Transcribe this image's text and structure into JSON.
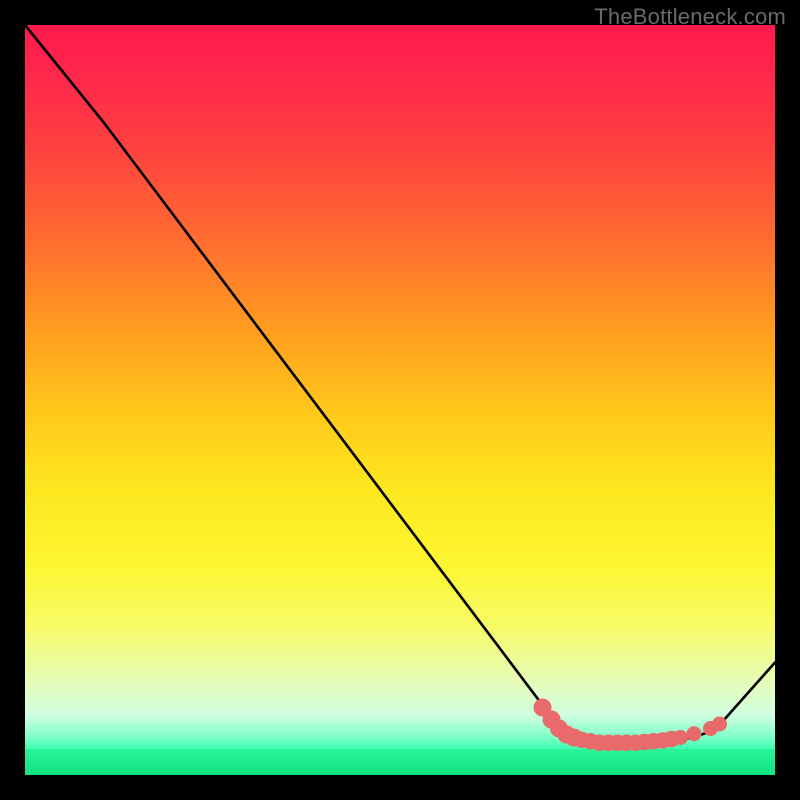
{
  "watermark": "TheBottleneck.com",
  "chart_data": {
    "type": "line",
    "title": "",
    "xlabel": "",
    "ylabel": "",
    "xlim": [
      0,
      100
    ],
    "ylim": [
      0,
      100
    ],
    "series": [
      {
        "name": "curve",
        "points": [
          {
            "x": 0.0,
            "y": 100.0
          },
          {
            "x": 10.5,
            "y": 87.0
          },
          {
            "x": 71.5,
            "y": 6.0
          },
          {
            "x": 74.0,
            "y": 4.5
          },
          {
            "x": 78.0,
            "y": 4.3
          },
          {
            "x": 82.0,
            "y": 4.3
          },
          {
            "x": 86.0,
            "y": 4.5
          },
          {
            "x": 89.0,
            "y": 5.0
          },
          {
            "x": 92.0,
            "y": 6.0
          },
          {
            "x": 100.0,
            "y": 15.0
          }
        ]
      }
    ],
    "markers": {
      "name": "highlight-dots",
      "color": "#e86a6a",
      "points": [
        {
          "x": 69.0,
          "y": 9.0,
          "r": 1.2
        },
        {
          "x": 70.2,
          "y": 7.4,
          "r": 1.2
        },
        {
          "x": 71.2,
          "y": 6.2,
          "r": 1.2
        },
        {
          "x": 72.2,
          "y": 5.4,
          "r": 1.2
        },
        {
          "x": 73.2,
          "y": 5.0,
          "r": 1.2
        },
        {
          "x": 74.2,
          "y": 4.7,
          "r": 1.1
        },
        {
          "x": 75.4,
          "y": 4.5,
          "r": 1.1
        },
        {
          "x": 76.6,
          "y": 4.3,
          "r": 1.1
        },
        {
          "x": 77.8,
          "y": 4.3,
          "r": 1.1
        },
        {
          "x": 79.0,
          "y": 4.3,
          "r": 1.1
        },
        {
          "x": 80.2,
          "y": 4.3,
          "r": 1.1
        },
        {
          "x": 81.4,
          "y": 4.3,
          "r": 1.1
        },
        {
          "x": 82.6,
          "y": 4.4,
          "r": 1.1
        },
        {
          "x": 83.8,
          "y": 4.5,
          "r": 1.1
        },
        {
          "x": 85.0,
          "y": 4.6,
          "r": 1.1
        },
        {
          "x": 86.2,
          "y": 4.8,
          "r": 1.1
        },
        {
          "x": 87.4,
          "y": 5.0,
          "r": 1.0
        },
        {
          "x": 89.2,
          "y": 5.5,
          "r": 1.0
        },
        {
          "x": 91.4,
          "y": 6.2,
          "r": 1.0
        },
        {
          "x": 92.6,
          "y": 6.8,
          "r": 1.0
        }
      ]
    }
  }
}
